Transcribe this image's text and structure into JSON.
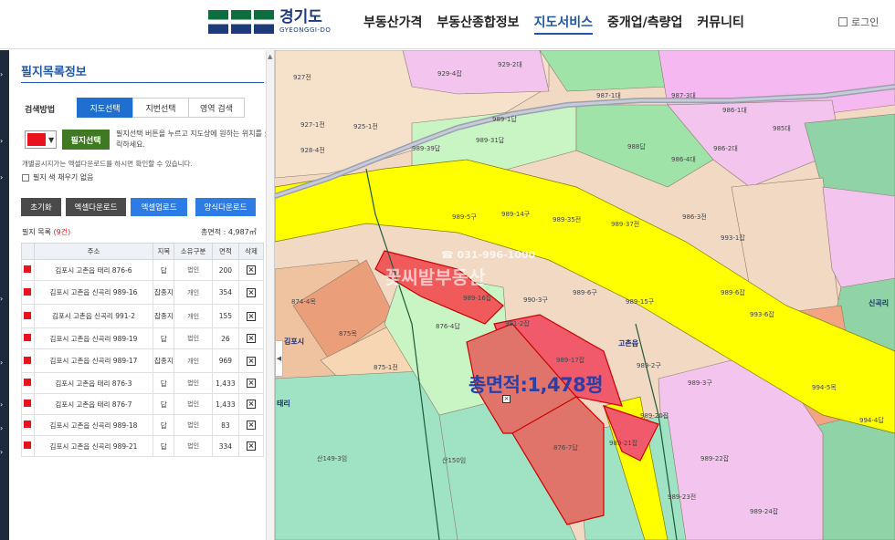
{
  "header": {
    "logo_text": "경기도",
    "logo_sub": "GYEONGGI-DO",
    "nav": [
      "부동산가격",
      "부동산종합정보",
      "지도서비스",
      "중개업/측량업",
      "커뮤니티"
    ],
    "login": "로그인"
  },
  "panel": {
    "title": "필지목록정보",
    "method_label": "검색방법",
    "tabs": [
      "지도선택",
      "지번선택",
      "영역 검색"
    ],
    "pick_button": "필지선택",
    "pick_desc": "필지선택 버튼을 누르고 지도상에 원하는 위치를 클릭하세요.",
    "notice": "개별공시지가는 엑셀다운로드를 하시면 확인할 수 있습니다.",
    "no_fill_label": "필지 색 채우기 없음",
    "buttons": [
      "초기화",
      "엑셀다운로드",
      "엑셀업로드",
      "양식다운로드"
    ],
    "list_label": "필지 목록",
    "list_count": "(9건)",
    "total_area": "총면적 : 4,987㎡",
    "columns": [
      "주소",
      "지목",
      "소유구분",
      "면적",
      "삭제"
    ],
    "rows": [
      {
        "addr": "김포시 고촌읍 태리 876-6",
        "jimok": "답",
        "owner": "법인",
        "area": "200"
      },
      {
        "addr": "김포시 고촌읍 신곡리 989-16",
        "jimok": "잡종지",
        "owner": "개인",
        "area": "354"
      },
      {
        "addr": "김포시 고촌읍 신곡리 991-2",
        "jimok": "잡종지",
        "owner": "개인",
        "area": "155"
      },
      {
        "addr": "김포시 고촌읍 신곡리 989-19",
        "jimok": "답",
        "owner": "법인",
        "area": "26"
      },
      {
        "addr": "김포시 고촌읍 신곡리 989-17",
        "jimok": "잡종지",
        "owner": "개인",
        "area": "969"
      },
      {
        "addr": "김포시 고촌읍 태리 876-3",
        "jimok": "답",
        "owner": "법인",
        "area": "1,433"
      },
      {
        "addr": "김포시 고촌읍 태리 876-7",
        "jimok": "답",
        "owner": "법인",
        "area": "1,433"
      },
      {
        "addr": "김포시 고촌읍 신곡리 989-18",
        "jimok": "답",
        "owner": "법인",
        "area": "83"
      },
      {
        "addr": "김포시 고촌읍 신곡리 989-21",
        "jimok": "답",
        "owner": "법인",
        "area": "334"
      }
    ]
  },
  "map": {
    "total_label": "총면적:1,478평",
    "watermark_phone": "☎ 031-996-1000",
    "watermark_name": "꽃씨밭부동산",
    "place_labels": [
      "김포시",
      "고촌읍",
      "태리",
      "신곡리"
    ],
    "parcel_labels": [
      "929-4잡",
      "929-2대",
      "927전",
      "927-1전",
      "925-1전",
      "928-4전",
      "989-1답",
      "989-31답",
      "989-39답",
      "988답",
      "987-1대",
      "987-3대",
      "986-1대",
      "985대",
      "986-4대",
      "986-2대",
      "986-3전",
      "993-1잡",
      "989-6잡",
      "993-6잡",
      "989-5구",
      "989-14구",
      "989-37전",
      "989-35전",
      "874-4목",
      "875목",
      "875-1전",
      "876-4답",
      "989-16잡",
      "991-2잡",
      "990-3구",
      "989-6구",
      "989-15구",
      "989-17잡",
      "989-2구",
      "989-3구",
      "989-20잡",
      "989-21잡",
      "989-22잡",
      "989-23전",
      "876-7답",
      "산149-3임",
      "산150임",
      "994-5목",
      "994-4답",
      "989-24잡"
    ]
  },
  "colors": {
    "brand": "#1f57a8",
    "selected_parcel": "#e8131c",
    "road": "#ffff00"
  }
}
